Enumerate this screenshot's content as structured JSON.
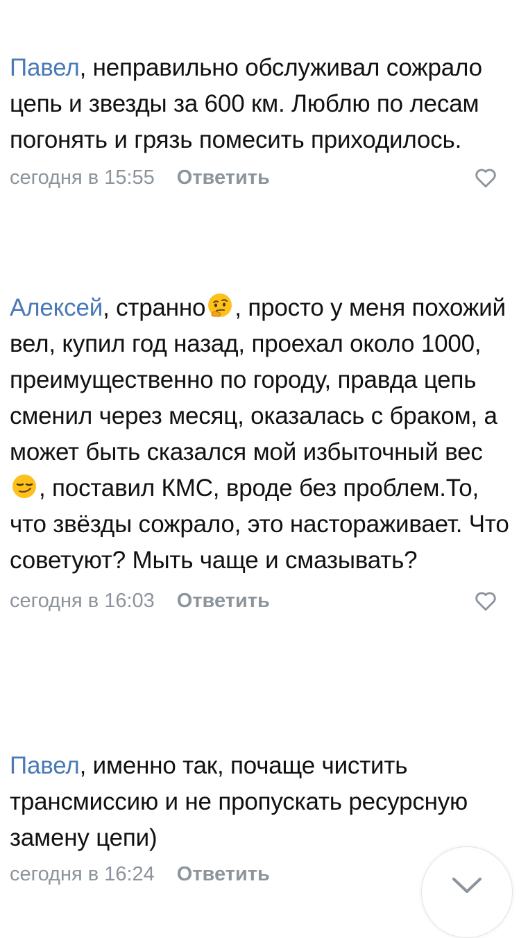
{
  "comments": [
    {
      "author": "Павел",
      "text_1": ", неправильно обслуживал сожрало цепь и звезды за 600 км. Люблю по лесам погонять и грязь помесить приходилось.",
      "time": "сегодня в 15:55",
      "reply_label": "Ответить",
      "like_icon": "heart-outline-icon"
    },
    {
      "author": "Алексей",
      "text_1": ", странно",
      "emoji_1": "thinking-face-emoji",
      "text_2": ", просто у меня похожий вел, купил год назад, проехал около 1000, преимущественно по городу, правда цепь сменил через месяц, оказалась с браком, а может быть сказался мой избыточный вес",
      "emoji_2": "smirking-face-emoji",
      "text_3": ", поставил КМС, вроде без проблем.То, что звёзды сожрало, это настораживает. Что советуют? Мыть чаще и смазывать?",
      "time": "сегодня в 16:03",
      "reply_label": "Ответить",
      "like_icon": "heart-outline-icon"
    },
    {
      "author": "Павел",
      "text_1": ", именно так, почаще чистить трансмиссию и не пропускать ресурсную замену цепи)",
      "time": "сегодня в 16:24",
      "reply_label": "Ответить"
    }
  ],
  "colors": {
    "author": "#4a79b5",
    "meta": "#8b939b",
    "text": "#111111"
  },
  "fab_icon": "chevron-down-icon"
}
